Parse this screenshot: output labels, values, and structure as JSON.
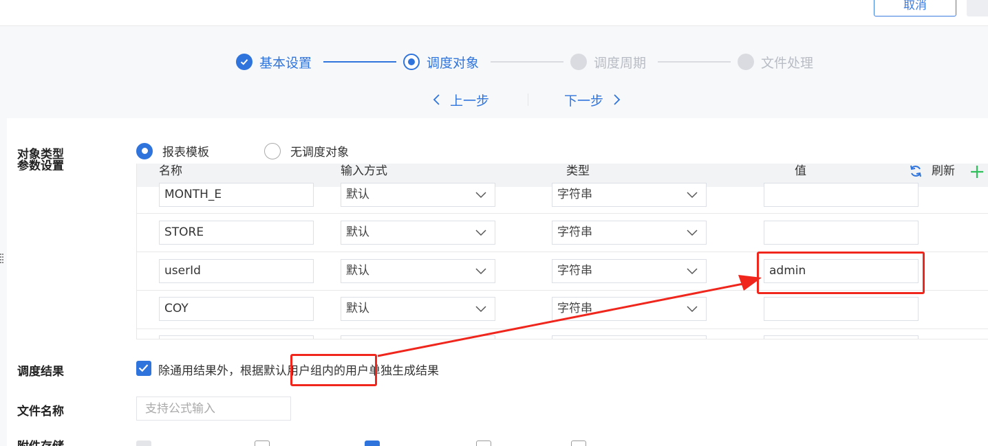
{
  "header": {
    "cancel_label": "取消"
  },
  "steps": [
    {
      "label": "基本设置",
      "state": "done"
    },
    {
      "label": "调度对象",
      "state": "current"
    },
    {
      "label": "调度周期",
      "state": "todo"
    },
    {
      "label": "文件处理",
      "state": "todo"
    }
  ],
  "pager": {
    "prev": "上一步",
    "next": "下一步"
  },
  "form": {
    "object_type_label": "对象类型",
    "param_label": "参数设置",
    "radio_options": [
      {
        "label": "报表模板",
        "selected": true
      },
      {
        "label": "无调度对象",
        "selected": false
      }
    ],
    "table": {
      "headers": {
        "name": "名称",
        "input_mode": "输入方式",
        "type": "类型",
        "value": "值"
      },
      "refresh_label": "刷新",
      "rows": [
        {
          "name": "MONTH_E",
          "input_mode": "默认",
          "type": "字符串",
          "value": ""
        },
        {
          "name": "STORE",
          "input_mode": "默认",
          "type": "字符串",
          "value": ""
        },
        {
          "name": "userId",
          "input_mode": "默认",
          "type": "字符串",
          "value": "admin"
        },
        {
          "name": "COY",
          "input_mode": "默认",
          "type": "字符串",
          "value": ""
        }
      ]
    },
    "result_label": "调度结果",
    "result_checkbox_text": "除通用结果外，根据默认用户组内的用户单独生成结果",
    "filename_label": "文件名称",
    "filename_placeholder": "支持公式输入",
    "attachment_label": "附件存储"
  },
  "colors": {
    "accent": "#2e74dc",
    "annotation": "#f0261d",
    "success": "#2fbf5b"
  }
}
